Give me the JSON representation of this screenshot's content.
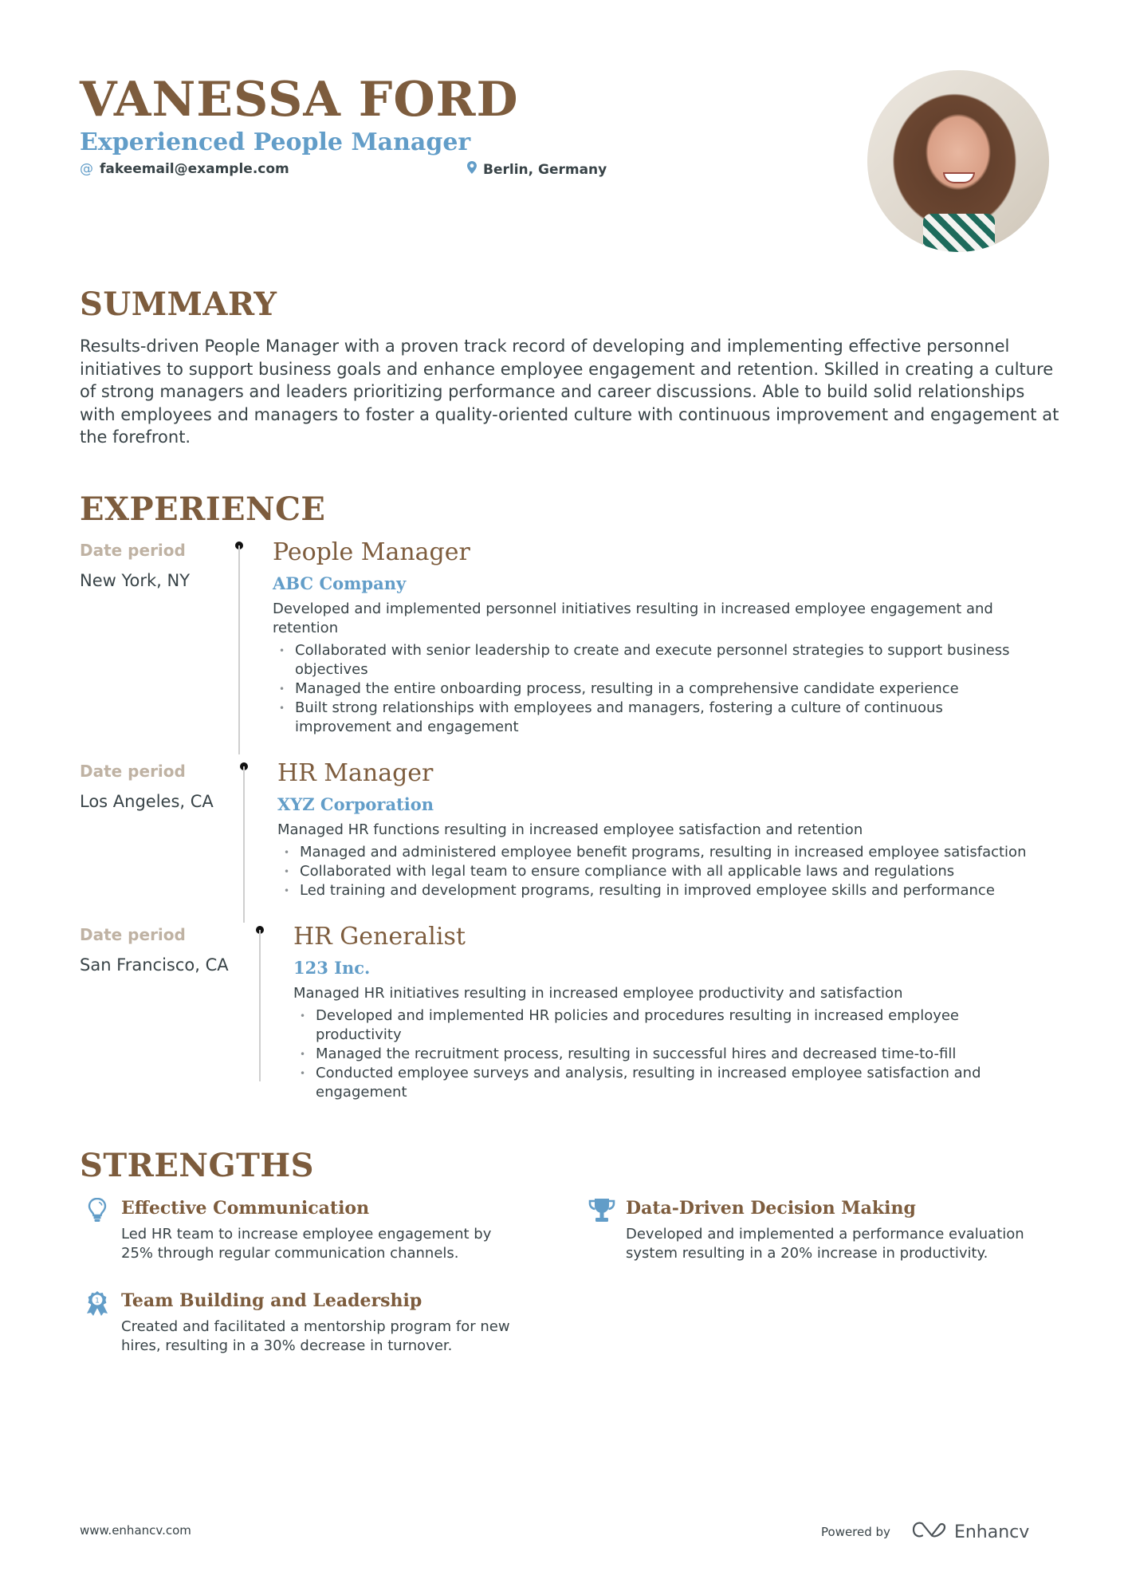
{
  "header": {
    "name": "VANESSA FORD",
    "role": "Experienced People Manager",
    "email": "fakeemail@example.com",
    "location": "Berlin, Germany",
    "email_icon": "at-icon",
    "location_icon": "map-pin-icon",
    "photo_alt": "profile-photo"
  },
  "summary": {
    "title": "SUMMARY",
    "text": "Results-driven People Manager with a proven track record of developing and implementing effective personnel initiatives to support business goals and enhance employee engagement and retention. Skilled in creating a culture of strong managers and leaders prioritizing performance and career discussions. Able to build solid relationships with employees and managers to foster a quality-oriented culture with continuous improvement and engagement at the forefront."
  },
  "experience": {
    "title": "EXPERIENCE",
    "items": [
      {
        "date": "Date period",
        "location": "New York, NY",
        "title": "People Manager",
        "company": "ABC Company",
        "description": "Developed and implemented personnel initiatives resulting in increased employee engagement and retention",
        "bullets": [
          "Collaborated with senior leadership to create and execute personnel strategies to support business objectives",
          "Managed the entire onboarding process, resulting in a comprehensive candidate experience",
          "Built strong relationships with employees and managers, fostering a culture of continuous improvement and engagement"
        ]
      },
      {
        "date": "Date period",
        "location": "Los Angeles, CA",
        "title": "HR Manager",
        "company": "XYZ Corporation",
        "description": "Managed HR functions resulting in increased employee satisfaction and retention",
        "bullets": [
          "Managed and administered employee benefit programs, resulting in increased employee satisfaction",
          "Collaborated with legal team to ensure compliance with all applicable laws and regulations",
          "Led training and development programs, resulting in improved employee skills and performance"
        ]
      },
      {
        "date": "Date period",
        "location": "San Francisco, CA",
        "title": "HR Generalist",
        "company": "123 Inc.",
        "description": "Managed HR initiatives resulting in increased employee productivity and satisfaction",
        "bullets": [
          "Developed and implemented HR policies and procedures resulting in increased employee productivity",
          "Managed the recruitment process, resulting in successful hires and decreased time-to-fill",
          "Conducted employee surveys and analysis, resulting in increased employee satisfaction and engagement"
        ]
      }
    ]
  },
  "strengths": {
    "title": "STRENGTHS",
    "items": [
      {
        "icon": "lightbulb-icon",
        "title": "Effective Communication",
        "text": "Led HR team to increase employee engagement by 25% through regular communication channels."
      },
      {
        "icon": "trophy-icon",
        "title": "Data-Driven Decision Making",
        "text": "Developed and implemented a performance evaluation system resulting in a 20% increase in productivity."
      },
      {
        "icon": "award-ribbon-icon",
        "title": "Team Building and Leadership",
        "text": "Created and facilitated a mentorship program for new hires, resulting in a 30% decrease in turnover.",
        "badge_number": "1"
      }
    ]
  },
  "footer": {
    "url": "www.enhancv.com",
    "powered_by": "Powered by",
    "brand": "Enhancv"
  },
  "colors": {
    "accent_brown": "#7d5c3d",
    "accent_blue": "#629dc8",
    "text": "#384347",
    "muted_date": "#bfb2a3"
  }
}
